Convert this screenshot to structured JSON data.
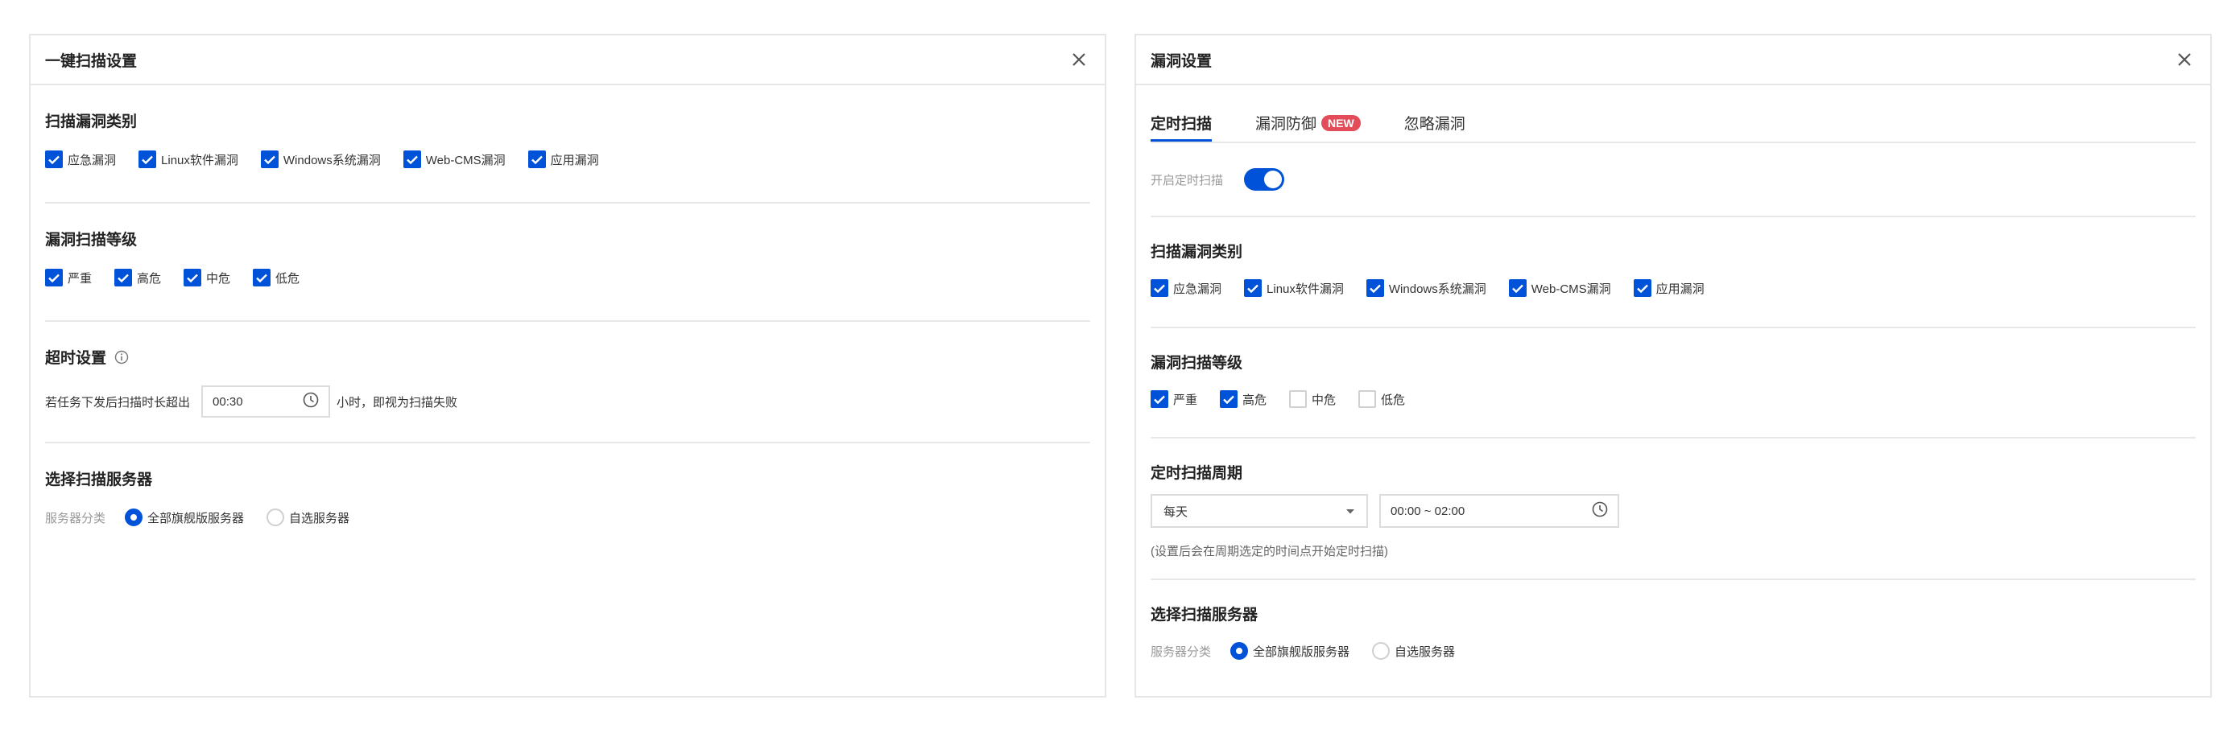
{
  "left": {
    "title": "一键扫描设置",
    "category": {
      "title": "扫描漏洞类别",
      "items": [
        {
          "label": "应急漏洞",
          "checked": true
        },
        {
          "label": "Linux软件漏洞",
          "checked": true
        },
        {
          "label": "Windows系统漏洞",
          "checked": true
        },
        {
          "label": "Web-CMS漏洞",
          "checked": true
        },
        {
          "label": "应用漏洞",
          "checked": true
        }
      ]
    },
    "level": {
      "title": "漏洞扫描等级",
      "items": [
        {
          "label": "严重",
          "checked": true
        },
        {
          "label": "高危",
          "checked": true
        },
        {
          "label": "中危",
          "checked": true
        },
        {
          "label": "低危",
          "checked": true
        }
      ]
    },
    "timeout": {
      "title": "超时设置",
      "prefix": "若任务下发后扫描时长超出",
      "value": "00:30",
      "suffix": "小时，即视为扫描失败"
    },
    "server": {
      "title": "选择扫描服务器",
      "label": "服务器分类",
      "options": [
        {
          "label": "全部旗舰版服务器",
          "selected": true
        },
        {
          "label": "自选服务器",
          "selected": false
        }
      ]
    }
  },
  "right": {
    "title": "漏洞设置",
    "tabs": [
      {
        "label": "定时扫描",
        "active": true
      },
      {
        "label": "漏洞防御",
        "badge": "NEW"
      },
      {
        "label": "忽略漏洞"
      }
    ],
    "toggle_label": "开启定时扫描",
    "toggle_on": true,
    "category": {
      "title": "扫描漏洞类别",
      "items": [
        {
          "label": "应急漏洞",
          "checked": true
        },
        {
          "label": "Linux软件漏洞",
          "checked": true
        },
        {
          "label": "Windows系统漏洞",
          "checked": true
        },
        {
          "label": "Web-CMS漏洞",
          "checked": true
        },
        {
          "label": "应用漏洞",
          "checked": true
        }
      ]
    },
    "level": {
      "title": "漏洞扫描等级",
      "items": [
        {
          "label": "严重",
          "checked": true
        },
        {
          "label": "高危",
          "checked": true
        },
        {
          "label": "中危",
          "checked": false
        },
        {
          "label": "低危",
          "checked": false
        }
      ]
    },
    "period": {
      "title": "定时扫描周期",
      "frequency": "每天",
      "time_range": "00:00 ~ 02:00",
      "hint": "(设置后会在周期选定的时间点开始定时扫描)"
    },
    "server": {
      "title": "选择扫描服务器",
      "label": "服务器分类",
      "options": [
        {
          "label": "全部旗舰版服务器",
          "selected": true
        },
        {
          "label": "自选服务器",
          "selected": false
        }
      ]
    }
  },
  "colors": {
    "accent": "#0052d9",
    "badge": "#e34d59"
  }
}
